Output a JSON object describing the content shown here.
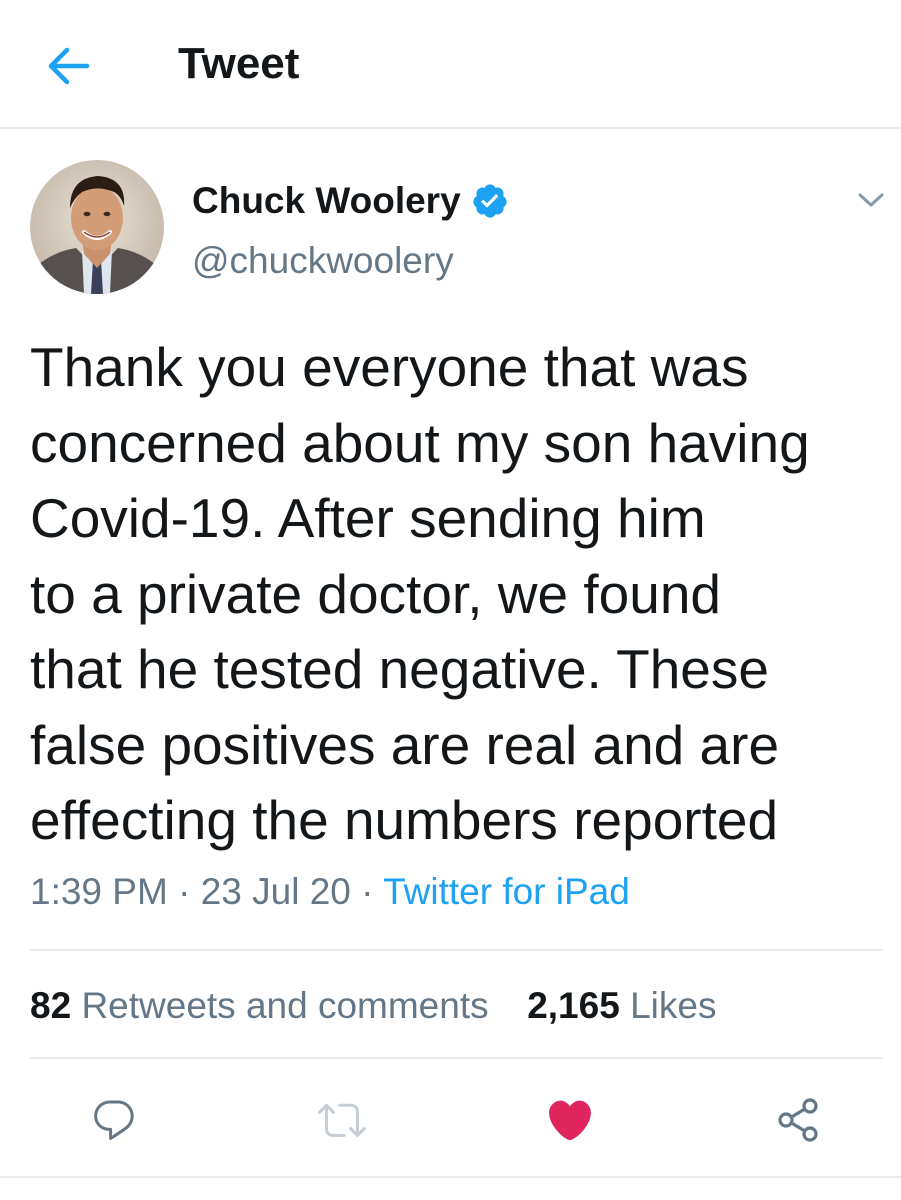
{
  "header": {
    "title": "Tweet",
    "back_icon": "arrow-left-icon"
  },
  "colors": {
    "accent": "#1da1f2",
    "like": "#e0245e",
    "muted": "#657786",
    "text": "#14171a",
    "divider": "#e6ecf0"
  },
  "author": {
    "display_name": "Chuck Woolery",
    "handle": "@chuckwoolery",
    "verified": true,
    "verified_icon": "verified-badge-icon",
    "menu_icon": "chevron-down-icon"
  },
  "tweet": {
    "lines": [
      "Thank you everyone that was",
      "concerned about my son having",
      "Covid-19. After sending him",
      "to a private doctor, we found",
      "that he tested negative. These",
      "false positives are real and are",
      "effecting the numbers reported"
    ],
    "time": "1:39 PM",
    "date": "23 Jul 20",
    "separator": " · ",
    "source": "Twitter for iPad"
  },
  "stats": {
    "retweets_count": "82",
    "retweets_label": "Retweets and comments",
    "likes_count": "2,165",
    "likes_label": "Likes"
  },
  "actions": [
    {
      "name": "reply",
      "icon": "reply-icon"
    },
    {
      "name": "retweet",
      "icon": "retweet-icon"
    },
    {
      "name": "like",
      "icon": "heart-icon",
      "active": true
    },
    {
      "name": "share",
      "icon": "share-icon"
    }
  ]
}
